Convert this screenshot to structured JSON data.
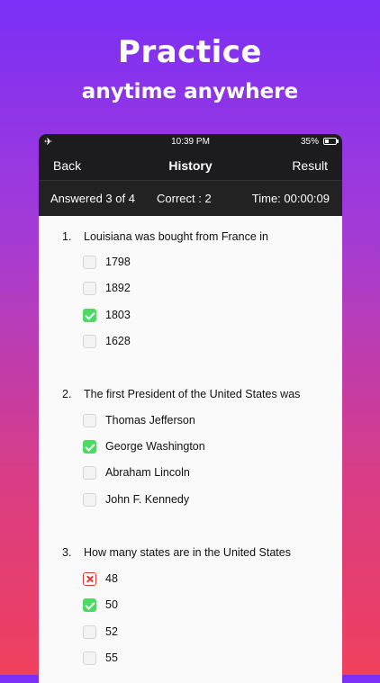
{
  "promo": {
    "title": "Practice",
    "subtitle": "anytime anywhere"
  },
  "status_bar": {
    "airplane_icon": "airplane-icon",
    "time": "10:39 PM",
    "battery": "35%"
  },
  "nav": {
    "back_label": "Back",
    "title": "History",
    "result_label": "Result"
  },
  "info": {
    "answered": "Answered  3 of 4",
    "correct": "Correct : 2",
    "time": "Time: 00:00:09"
  },
  "questions": [
    {
      "number": "1.",
      "text": "Louisiana was bought from France in",
      "options": [
        {
          "label": "1798",
          "state": "unchecked"
        },
        {
          "label": "1892",
          "state": "unchecked"
        },
        {
          "label": "1803",
          "state": "correct"
        },
        {
          "label": "1628",
          "state": "unchecked"
        }
      ]
    },
    {
      "number": "2.",
      "text": "The first President of the United States was",
      "options": [
        {
          "label": "Thomas Jefferson",
          "state": "unchecked"
        },
        {
          "label": "George Washington",
          "state": "correct"
        },
        {
          "label": "Abraham Lincoln",
          "state": "unchecked"
        },
        {
          "label": "John F. Kennedy",
          "state": "unchecked"
        }
      ]
    },
    {
      "number": "3.",
      "text": "How many states are in the United States",
      "options": [
        {
          "label": "48",
          "state": "wrong"
        },
        {
          "label": "50",
          "state": "correct"
        },
        {
          "label": "52",
          "state": "unchecked"
        },
        {
          "label": "55",
          "state": "unchecked"
        }
      ]
    }
  ],
  "colors": {
    "correct": "#4cd964",
    "wrong": "#e53935",
    "header_bg": "#1c1c1e"
  }
}
